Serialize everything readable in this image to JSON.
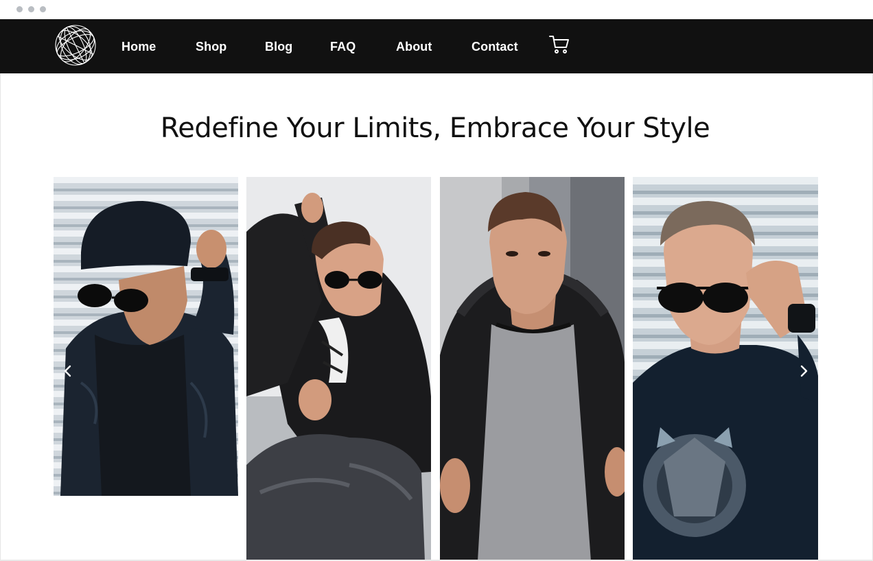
{
  "nav": {
    "items": [
      {
        "label": "Home"
      },
      {
        "label": "Shop"
      },
      {
        "label": "Blog"
      },
      {
        "label": "FAQ"
      },
      {
        "label": "About"
      },
      {
        "label": "Contact"
      }
    ],
    "logo_icon": "wireframe-globe-icon",
    "cart_icon": "shopping-cart-icon"
  },
  "hero": {
    "headline": "Redefine Your Limits, Embrace Your Style"
  },
  "gallery": {
    "images": [
      {
        "name": "man-black-cap-sunglasses-puffer-jacket"
      },
      {
        "name": "man-sunglasses-black-cardigan-sitting"
      },
      {
        "name": "man-black-puffer-grey-tshirt"
      },
      {
        "name": "man-sunglasses-navy-graphic-tee"
      }
    ],
    "prev_icon": "chevron-left-icon",
    "next_icon": "chevron-right-icon"
  },
  "colors": {
    "navbar_bg": "#111111",
    "nav_text": "#ffffff",
    "headline": "#111111",
    "background": "#ffffff"
  }
}
